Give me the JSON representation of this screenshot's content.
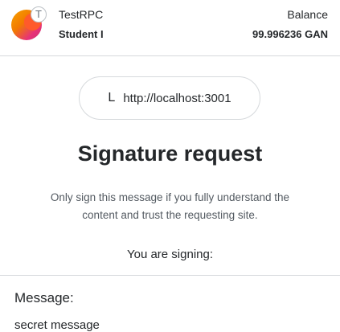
{
  "header": {
    "network_name": "TestRPC",
    "network_badge_letter": "T",
    "account_name": "Student I",
    "balance_label": "Balance",
    "balance_value": "99.996236 GAN"
  },
  "origin": {
    "icon_letter": "L",
    "url": "http://localhost:3001"
  },
  "request": {
    "title": "Signature request",
    "description": "Only sign this message if you fully understand the content and trust the requesting site.",
    "signing_label": "You are signing:"
  },
  "message": {
    "label": "Message:",
    "value": "secret message"
  },
  "colors": {
    "text": "#24272a",
    "muted": "#535a61",
    "border": "#d6d9dc"
  }
}
